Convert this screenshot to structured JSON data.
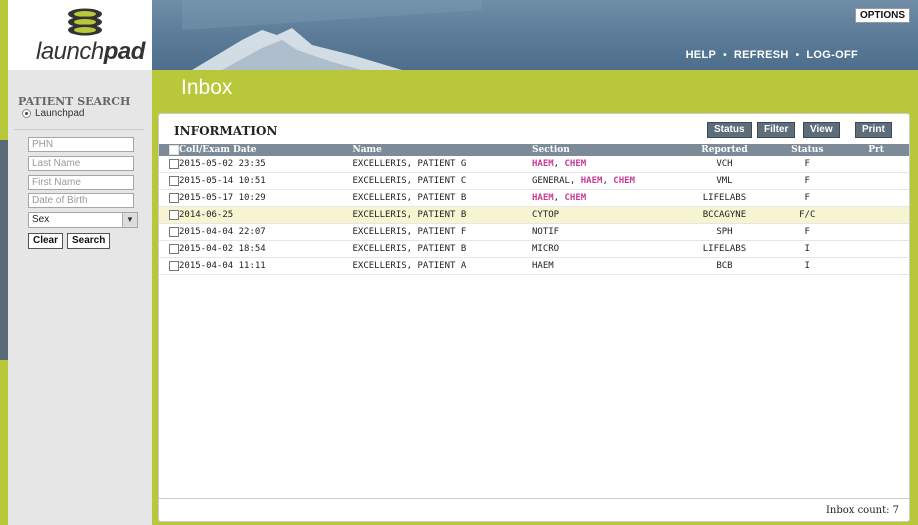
{
  "app": {
    "logo_text_light": "launch",
    "logo_text_bold": "pad"
  },
  "header": {
    "options_label": "OPTIONS",
    "nav": [
      "HELP",
      "REFRESH",
      "LOG-OFF"
    ]
  },
  "sidebar": {
    "title": "PATIENT SEARCH",
    "radio_label": "Launchpad",
    "fields": {
      "phn_placeholder": "PHN",
      "last_name_placeholder": "Last Name",
      "first_name_placeholder": "First Name",
      "dob_placeholder": "Date of Birth",
      "sex_value": "Sex"
    },
    "clear_label": "Clear",
    "search_label": "Search"
  },
  "main": {
    "page_title": "Inbox",
    "panel_title": "INFORMATION",
    "toolbar": [
      "Status",
      "Filter",
      "View",
      "Print"
    ],
    "columns": [
      "Coll/Exam Date",
      "Name",
      "Section",
      "Reported",
      "Status",
      "Prt"
    ],
    "rows": [
      {
        "date": "2015-05-02 23:35",
        "name": "EXCELLERIS, PATIENT G",
        "section": [
          {
            "t": "HAEM",
            "link": true
          },
          {
            "t": ", ",
            "link": false
          },
          {
            "t": "CHEM",
            "link": true
          }
        ],
        "reported": "VCH",
        "status": "F",
        "prt": "",
        "highlight": false
      },
      {
        "date": "2015-05-14 10:51",
        "name": "EXCELLERIS, PATIENT C",
        "section": [
          {
            "t": "GENERAL, ",
            "link": false
          },
          {
            "t": "HAEM",
            "link": true
          },
          {
            "t": ", ",
            "link": false
          },
          {
            "t": "CHEM",
            "link": true
          }
        ],
        "reported": "VML",
        "status": "F",
        "prt": "",
        "highlight": false
      },
      {
        "date": "2015-05-17 10:29",
        "name": "EXCELLERIS, PATIENT B",
        "section": [
          {
            "t": "HAEM",
            "link": true
          },
          {
            "t": ", ",
            "link": false
          },
          {
            "t": "CHEM",
            "link": true
          }
        ],
        "reported": "LIFELABS",
        "status": "F",
        "prt": "",
        "highlight": false
      },
      {
        "date": "2014-06-25",
        "name": "EXCELLERIS, PATIENT B",
        "section": [
          {
            "t": "CYTOP",
            "link": false
          }
        ],
        "reported": "BCCAGYNE",
        "status": "F/C",
        "prt": "",
        "highlight": true
      },
      {
        "date": "2015-04-04 22:07",
        "name": "EXCELLERIS, PATIENT F",
        "section": [
          {
            "t": "NOTIF",
            "link": false
          }
        ],
        "reported": "SPH",
        "status": "F",
        "prt": "",
        "highlight": false
      },
      {
        "date": "2015-04-02 18:54",
        "name": "EXCELLERIS, PATIENT B",
        "section": [
          {
            "t": "MICRO",
            "link": false
          }
        ],
        "reported": "LIFELABS",
        "status": "I",
        "prt": "",
        "highlight": false
      },
      {
        "date": "2015-04-04 11:11",
        "name": "EXCELLERIS, PATIENT A",
        "section": [
          {
            "t": "HAEM",
            "link": false
          }
        ],
        "reported": "BCB",
        "status": "I",
        "prt": "",
        "highlight": false
      }
    ],
    "footer_count": "Inbox count: 7"
  },
  "colors": {
    "accent_lime": "#b9c83a",
    "header_blue": "#5f7f9b",
    "table_header": "#7d8b98",
    "link_magenta": "#c83a95",
    "row_highlight": "#f7f4d2"
  },
  "icons": [
    "launchpad-logo-icon",
    "radio-icon",
    "checkbox-icon",
    "dropdown-arrow-icon",
    "mountain-banner-image"
  ]
}
